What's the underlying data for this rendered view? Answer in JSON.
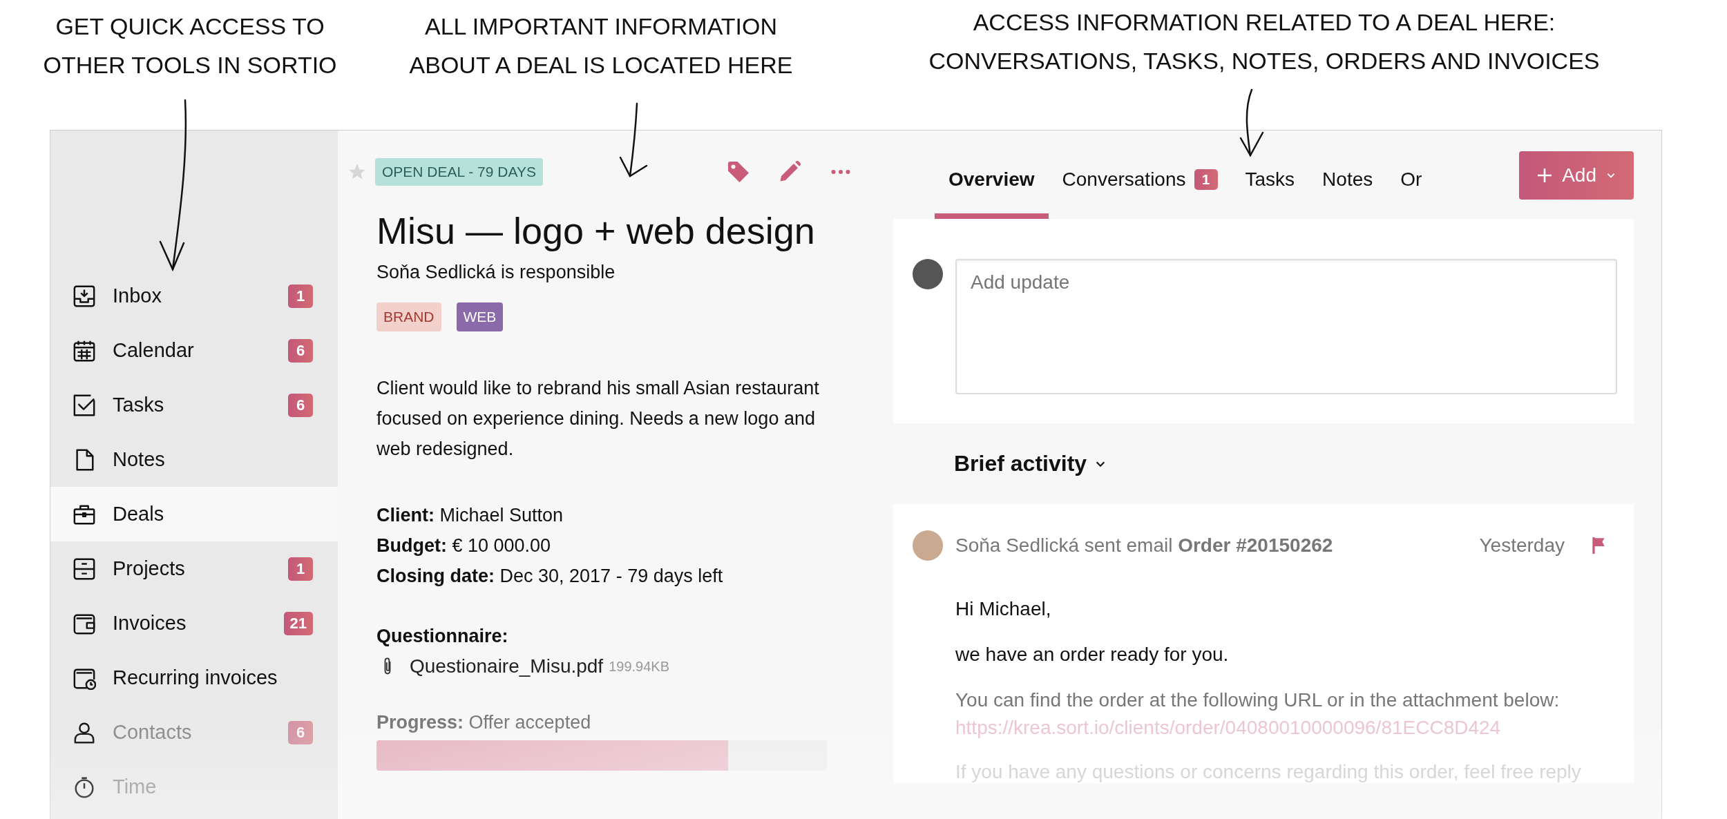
{
  "annotations": [
    {
      "lines": [
        "GET QUICK ACCESS TO",
        "OTHER TOOLS IN SORTIO"
      ]
    },
    {
      "lines": [
        "ALL IMPORTANT INFORMATION",
        "ABOUT A DEAL IS LOCATED HERE"
      ]
    },
    {
      "lines": [
        "ACCESS INFORMATION RELATED TO A DEAL HERE:",
        "CONVERSATIONS, TASKS, NOTES, ORDERS AND INVOICES"
      ]
    }
  ],
  "sidebar": {
    "items": [
      {
        "label": "Inbox",
        "badge": "1",
        "selected": false
      },
      {
        "label": "Calendar",
        "badge": "6",
        "selected": false
      },
      {
        "label": "Tasks",
        "badge": "6",
        "selected": false
      },
      {
        "label": "Notes",
        "selected": false
      },
      {
        "label": "Deals",
        "selected": true
      },
      {
        "label": "Projects",
        "badge": "1",
        "selected": false
      },
      {
        "label": "Invoices",
        "badge": "21",
        "selected": false
      },
      {
        "label": "Recurring invoices",
        "selected": false
      },
      {
        "label": "Contacts",
        "badge": "6",
        "selected": false
      },
      {
        "label": "Time",
        "selected": false
      }
    ]
  },
  "deal": {
    "starred": false,
    "status": "OPEN DEAL - 79 DAYS",
    "title": "Misu — logo + web design",
    "responsible": "Soňa Sedlická is responsible",
    "tags": [
      {
        "label": "BRAND",
        "color": "#f2d0cc"
      },
      {
        "label": "WEB",
        "color": "#8a6aa8"
      }
    ],
    "description": "Client would like to rebrand his small Asian restaurant focused on experience dining. Needs a new logo and web redesigned.",
    "details": [
      "**Client:** Michael Sutton",
      "**Budget:** € 10 000.00",
      "**Closing date:** Dec 30, 2017 - 79 days left"
    ],
    "questionnaire": {
      "heading": "Questionnaire:",
      "file": "Questionaire_Misu.pdf",
      "size": "199.94KB"
    },
    "progress": {
      "text": "**Progress:** Offer accepted",
      "level": 0.78
    }
  },
  "tabs": [
    {
      "label": "Overview",
      "selected": true
    },
    {
      "label": "Conversations",
      "badge": "1",
      "selected": false
    },
    {
      "label": "Tasks",
      "selected": false
    },
    {
      "label": "Notes",
      "selected": false
    },
    {
      "label": "Or",
      "selected": false
    }
  ],
  "add_button": {
    "label": "Add"
  },
  "update": {
    "placeholder": "Add update"
  },
  "activity": {
    "heading": "Brief activity",
    "entries": [
      {
        "summary": "Soňa Sedlická sent email **Order #20150262**",
        "time": "Yesterday",
        "flagged": true,
        "body": [
          {
            "kind": "text",
            "text": "Hi Michael,"
          },
          {
            "kind": "text",
            "text": "we have an order ready for you."
          },
          {
            "kind": "muted",
            "text": "You can find the order at the following URL or in the attachment below:"
          },
          {
            "kind": "link",
            "text": "https://krea.sort.io/clients/order/04080010000096/81ECC8D424"
          },
          {
            "kind": "muted",
            "text": "If you have any questions or concerns regarding this order, feel free reply"
          }
        ]
      }
    ]
  }
}
